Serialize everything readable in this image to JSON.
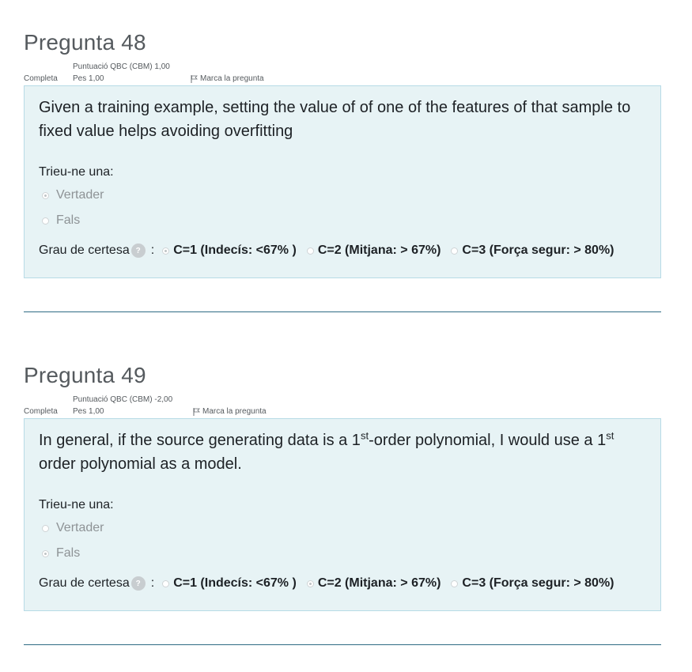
{
  "questions": [
    {
      "title": "Pregunta 48",
      "state": "Completa",
      "score": "Puntuació QBC (CBM) 1,00",
      "mark": "Pes 1,00",
      "flag_label": "Marca la pregunta",
      "text_html": "Given a training example, setting the value of of one of the features of that sample to fixed value helps avoiding overfitting",
      "prompt": "Trieu-ne una:",
      "options": [
        {
          "label": "Vertader",
          "checked": true
        },
        {
          "label": "Fals",
          "checked": false
        }
      ],
      "cbm_label": "Grau de certesa",
      "cbm_help": "?",
      "cbm_colon": ":",
      "cbm_options": [
        {
          "label": "C=1 (Indecís: <67% )",
          "checked": true
        },
        {
          "label": "C=2 (Mitjana: > 67%)",
          "checked": false
        },
        {
          "label": "C=3 (Força segur: > 80%)",
          "checked": false
        }
      ]
    },
    {
      "title": "Pregunta 49",
      "state": "Completa",
      "score": "Puntuació QBC (CBM) -2,00",
      "mark": "Pes 1,00",
      "flag_label": "Marca la pregunta",
      "text_parts": [
        "In general, if the source generating data is a 1",
        "st",
        "-order polynomial, I would use a 1",
        "st",
        " order polynomial as a model."
      ],
      "prompt": "Trieu-ne una:",
      "options": [
        {
          "label": "Vertader",
          "checked": false
        },
        {
          "label": "Fals",
          "checked": true
        }
      ],
      "cbm_label": "Grau de certesa",
      "cbm_help": "?",
      "cbm_colon": ":",
      "cbm_options": [
        {
          "label": "C=1 (Indecís: <67% )",
          "checked": false
        },
        {
          "label": "C=2 (Mitjana: > 67%)",
          "checked": true
        },
        {
          "label": "C=3 (Força segur: > 80%)",
          "checked": false
        }
      ]
    }
  ]
}
